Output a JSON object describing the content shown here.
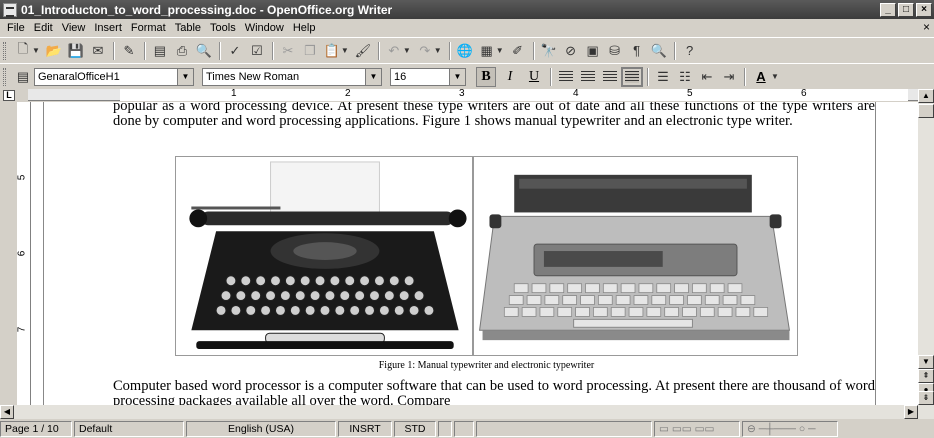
{
  "window": {
    "title": "01_Introducton_to_word_processing.doc - OpenOffice.org Writer",
    "minimize": "_",
    "maximize": "□",
    "close": "×"
  },
  "menu": {
    "items": [
      "File",
      "Edit",
      "View",
      "Insert",
      "Format",
      "Table",
      "Tools",
      "Window",
      "Help"
    ],
    "close_doc": "×"
  },
  "formatting": {
    "style": "GenaralOfficeH1",
    "font_name": "Times New Roman",
    "font_size": "16",
    "bold": "B",
    "italic": "I",
    "underline": "U",
    "font_color_glyph": "A"
  },
  "ruler": {
    "corner": "L",
    "h_numbers": [
      "1",
      "2",
      "3",
      "4",
      "5",
      "6"
    ],
    "v_numbers": [
      "5",
      "6",
      "7"
    ]
  },
  "document": {
    "para_top": "popular as a word processing device. At present these type writers are out of date and all these functions of the type writers are done by computer and word processing applications. Figure 1 shows manual typewriter and an electronic type writer.",
    "caption": "Figure 1: Manual typewriter and electronic typewriter",
    "para_bottom": "Computer based word processor is a computer software that can be used to word processing. At present there are thousand of word processing packages available all over the word. Compare"
  },
  "status": {
    "page": "Page 1 / 10",
    "page_style": "Default",
    "language": "English (USA)",
    "insert_mode": "INSRT",
    "selection_mode": "STD"
  },
  "colors": {
    "titlebar": "#4a4a4a",
    "chrome": "#d4d0c8",
    "paper": "#ffffff"
  }
}
